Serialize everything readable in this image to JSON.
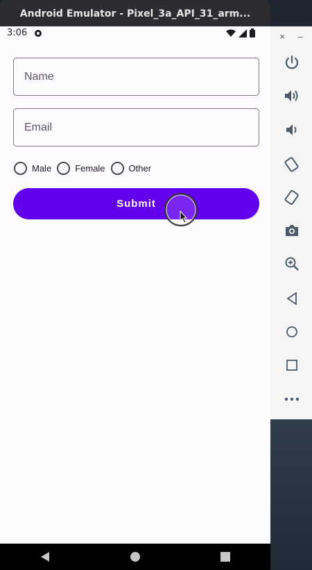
{
  "window": {
    "title": "Android Emulator - Pixel_3a_API_31_arm..."
  },
  "status_bar": {
    "time": "3:06"
  },
  "form": {
    "name_placeholder": "Name",
    "email_placeholder": "Email",
    "gender_options": [
      "Male",
      "Female",
      "Other"
    ],
    "submit_label": "Submit"
  },
  "side_panel": {
    "close_label": "×",
    "minimize_label": "–",
    "icons": [
      "power-icon",
      "volume-up-icon",
      "volume-down-icon",
      "rotate-left-icon",
      "rotate-right-icon",
      "camera-icon",
      "zoom-icon",
      "back-icon",
      "home-icon",
      "overview-icon",
      "more-icon"
    ]
  },
  "colors": {
    "accent": "#6200ee",
    "field_border": "#79747e",
    "screen_bg": "#fefbff",
    "titlebar_bg": "#2b2d31"
  }
}
